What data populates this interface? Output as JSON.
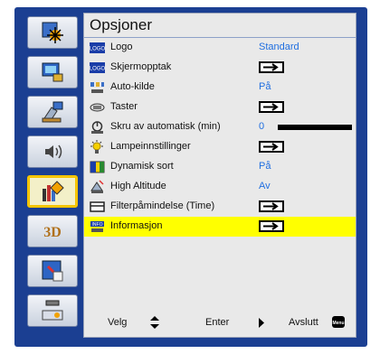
{
  "menu": {
    "title": "Opsjoner",
    "sidebar": [
      {
        "name": "image-settings-icon"
      },
      {
        "name": "display-settings-icon"
      },
      {
        "name": "setup-icon"
      },
      {
        "name": "audio-icon"
      },
      {
        "name": "options-icon",
        "active": true
      },
      {
        "name": "3d-icon",
        "label": "3D"
      },
      {
        "name": "lan-icon"
      },
      {
        "name": "network-icon"
      }
    ],
    "rows": [
      {
        "icon": "logo-icon",
        "label": "Logo",
        "value": "Standard",
        "type": "value"
      },
      {
        "icon": "logo-capture-icon",
        "label": "Skjermopptak",
        "type": "arrow"
      },
      {
        "icon": "auto-source-icon",
        "label": "Auto-kilde",
        "value": "På",
        "type": "value"
      },
      {
        "icon": "keypad-icon",
        "label": "Taster",
        "type": "arrow"
      },
      {
        "icon": "auto-power-off-icon",
        "label": "Skru av automatisk (min)",
        "value": "0",
        "type": "slider"
      },
      {
        "icon": "lamp-settings-icon",
        "label": "Lampeinnstillinger",
        "type": "arrow"
      },
      {
        "icon": "dynamic-black-icon",
        "label": "Dynamisk sort",
        "value": "På",
        "type": "value"
      },
      {
        "icon": "high-altitude-icon",
        "label": "High Altitude",
        "value": "Av",
        "type": "value"
      },
      {
        "icon": "filter-reminder-icon",
        "label": "Filterpåmindelse (Time)",
        "type": "arrow"
      },
      {
        "icon": "information-icon",
        "label": "Informasjon",
        "type": "arrow",
        "highlighted": true
      }
    ],
    "footer": {
      "select_label": "Velg",
      "enter_label": "Enter",
      "exit_label": "Avslutt",
      "menu_key": "Menu"
    },
    "colors": {
      "frame": "#1b3f92",
      "highlight": "#ffff00",
      "value": "#1f6ee0",
      "active_border": "#f5c400"
    }
  }
}
